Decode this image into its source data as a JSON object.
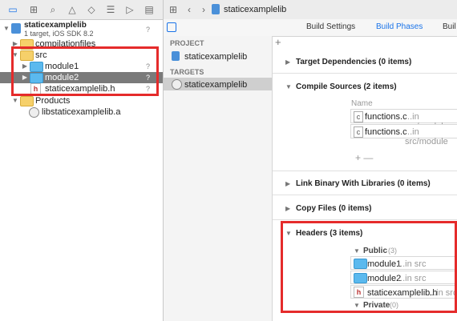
{
  "navigator": {
    "project": {
      "name": "staticexamplelib",
      "subtitle": "1 target, iOS SDK 8.2",
      "badge": "?"
    },
    "items": [
      {
        "label": "compilationfiles"
      },
      {
        "label": "src"
      },
      {
        "label": "module1",
        "badge": "?"
      },
      {
        "label": "module2",
        "badge": "?"
      },
      {
        "label": "staticexamplelib.h",
        "badge": "?"
      },
      {
        "label": "Products"
      },
      {
        "label": "libstaticexamplelib.a"
      }
    ]
  },
  "editor": {
    "breadcrumb": "staticexamplelib",
    "tabs": [
      "Build Settings",
      "Build Phases",
      "Buil"
    ],
    "sidebar": {
      "project_header": "PROJECT",
      "project_item": "staticexamplelib",
      "targets_header": "TARGETS",
      "target_item": "staticexamplelib",
      "add_symbol": "+"
    },
    "phases": {
      "target_dependencies": "Target Dependencies (0 items)",
      "compile_sources": "Compile Sources (2 items)",
      "column_name": "Name",
      "compile_files": [
        {
          "name": "functions.c",
          "location": "...in src/module"
        },
        {
          "name": "functions.c",
          "location": "...in src/module"
        }
      ],
      "add_remove": "+  —",
      "link_binary": "Link Binary With Libraries (0 items)",
      "copy_files": "Copy Files (0 items)",
      "headers": "Headers (3 items)",
      "public_label": "Public",
      "public_count": "(3)",
      "header_files": [
        {
          "name": "module1",
          "location": "...in src"
        },
        {
          "name": "module2",
          "location": "...in src"
        },
        {
          "name": "staticexamplelib.h",
          "location": "...in src"
        }
      ],
      "private_label": "Private",
      "private_count": "(0)"
    }
  },
  "colors": {
    "accent": "#1a73e8",
    "highlight": "#e52b2b",
    "selection": "#7a7a7a"
  }
}
